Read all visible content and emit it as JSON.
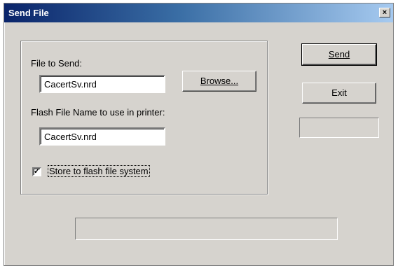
{
  "window": {
    "title": "Send File",
    "close_glyph": "×"
  },
  "form": {
    "file_to_send_label": "File to Send:",
    "file_to_send_value": "CacertSv.nrd",
    "browse_label": "Browse...",
    "flash_name_label": "Flash File Name to use in printer:",
    "flash_name_value": "CacertSv.nrd",
    "store_checkbox_label": "Store to flash file system",
    "store_checked": true,
    "check_glyph": "✓"
  },
  "actions": {
    "send_label": "Send",
    "exit_label": "Exit",
    "status_text": ""
  },
  "progress": {
    "value": 0
  }
}
